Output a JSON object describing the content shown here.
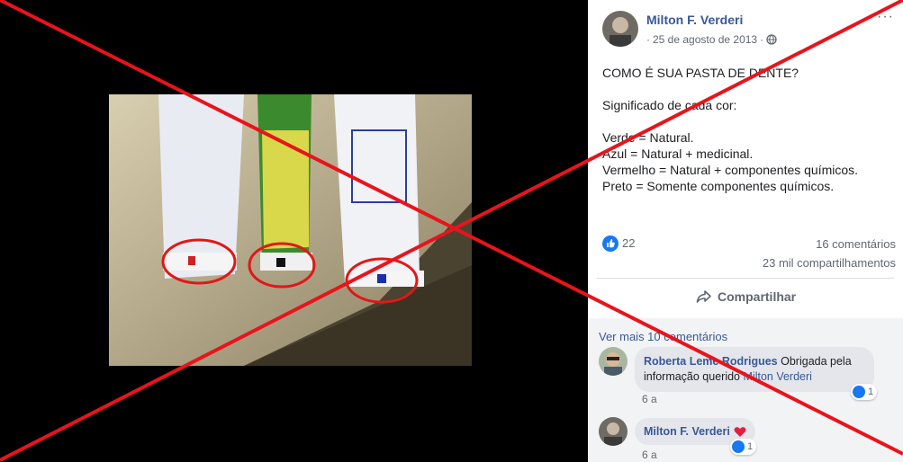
{
  "post": {
    "author": "Milton F. Verderi",
    "date": "25 de agosto de 2013",
    "more_icon": "···",
    "text_lines": [
      "COMO É SUA PASTA DE DENTE?",
      "",
      "Significado de cada cor:",
      "",
      "Verde = Natural.",
      "Azul = Natural + medicinal.",
      "Vermelho = Natural + componentes químicos.",
      "Preto = Somente componentes químicos."
    ],
    "likes": "22",
    "comments_count": "16 comentários",
    "shares_count": "23 mil compartilhamentos",
    "share_label": "Compartilhar"
  },
  "comments": {
    "view_more": "Ver mais 10 comentários",
    "items": [
      {
        "name": "Roberta Leme Rodrigues",
        "text_1": "Obrigada pela",
        "text_2": "informação querido",
        "mention": "Milton Verderi",
        "reactions": "1",
        "time": "6 a"
      },
      {
        "name": "Milton F. Verderi",
        "reactions": "1",
        "time": "6 a"
      }
    ]
  },
  "colors": {
    "link": "#385898",
    "cross": "#e8141c",
    "like_blue": "#1877f2",
    "heart": "#e41e3f"
  },
  "icons": [
    "globe-icon",
    "like-icon",
    "share-icon",
    "heart-icon",
    "more-icon"
  ]
}
